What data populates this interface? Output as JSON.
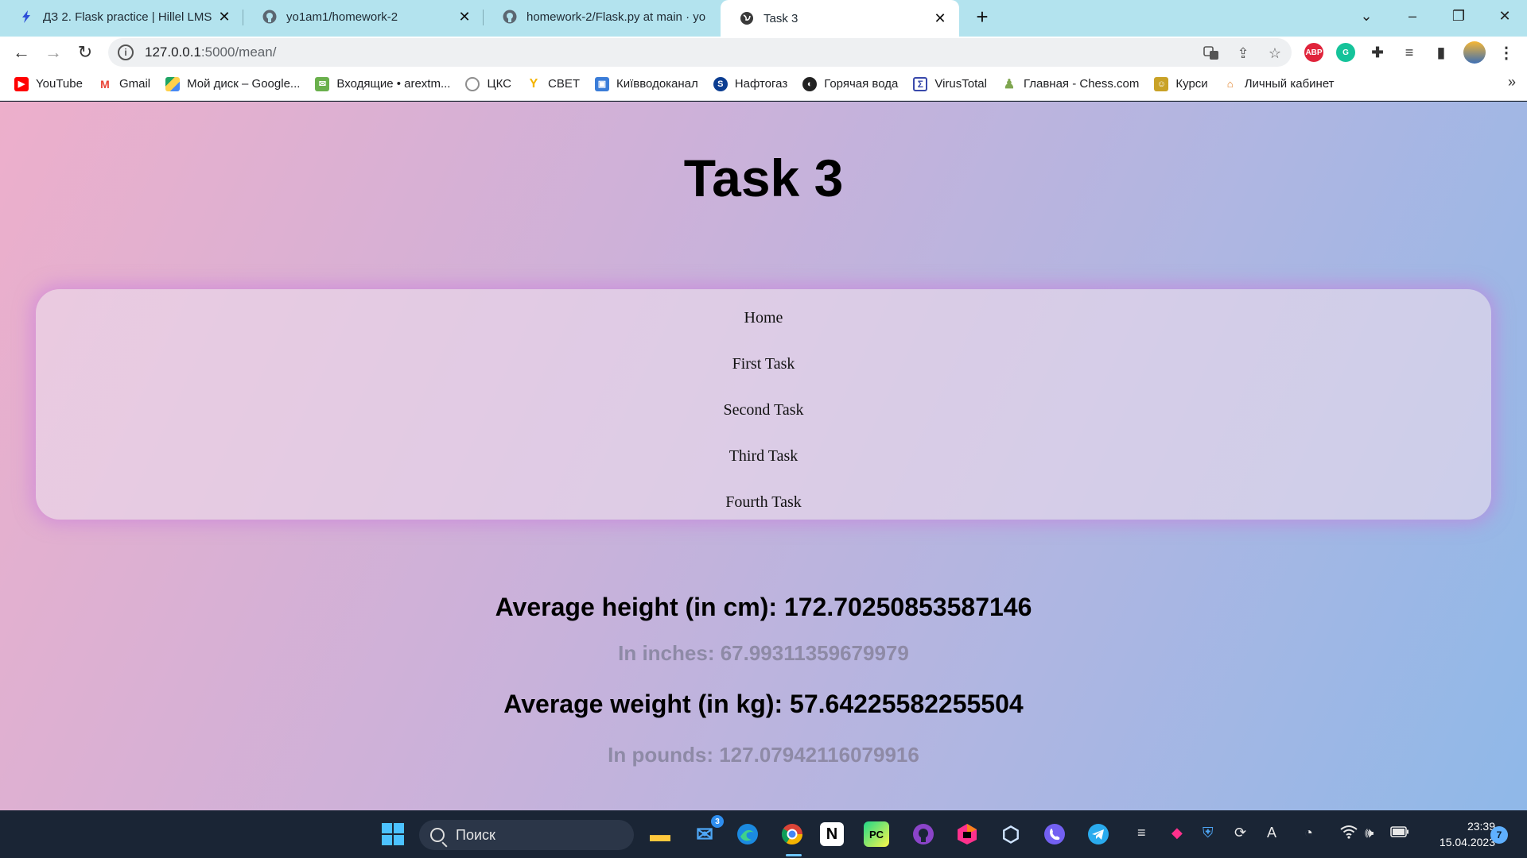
{
  "browser": {
    "tabs": [
      {
        "title": "ДЗ 2. Flask practice | Hillel LMS",
        "favicon": "hillel-icon",
        "active": false
      },
      {
        "title": "yo1am1/homework-2",
        "favicon": "github-icon",
        "active": false
      },
      {
        "title": "homework-2/Flask.py at main · yo",
        "favicon": "github-icon",
        "active": false
      },
      {
        "title": "Task 3",
        "favicon": "globe-icon",
        "active": true
      }
    ],
    "url_host": "127.0.0.1",
    "url_path": ":5000/mean/",
    "bookmarks": [
      {
        "label": "YouTube",
        "icon": "youtube-icon",
        "color": "#ff0000"
      },
      {
        "label": "Gmail",
        "icon": "gmail-icon",
        "color": "#ea4335"
      },
      {
        "label": "Мой диск – Google...",
        "icon": "google-drive-icon",
        "color": "#1fa463"
      },
      {
        "label": "Входящие • arextm...",
        "icon": "mail-icon",
        "color": "#6ab04c"
      },
      {
        "label": "ЦКС",
        "icon": "cks-icon",
        "color": "#8e8e8e"
      },
      {
        "label": "СВЕТ",
        "icon": "svet-icon",
        "color": "#f4b400"
      },
      {
        "label": "Київводоканал",
        "icon": "vodokanal-icon",
        "color": "#3b7dd8"
      },
      {
        "label": "Нафтогаз",
        "icon": "naftogaz-icon",
        "color": "#0b3d91"
      },
      {
        "label": "Горячая вода",
        "icon": "globe-icon",
        "color": "#222222"
      },
      {
        "label": "VirusTotal",
        "icon": "virustotal-icon",
        "color": "#3949ab"
      },
      {
        "label": "Главная - Chess.com",
        "icon": "chess-icon",
        "color": "#7fa650"
      },
      {
        "label": "Курси",
        "icon": "courses-icon",
        "color": "#c9a227"
      },
      {
        "label": "Личный кабинет",
        "icon": "cabinet-icon",
        "color": "#e07b1f"
      }
    ]
  },
  "page": {
    "title": "Task 3",
    "nav": [
      "Home",
      "First Task",
      "Second Task",
      "Third Task",
      "Fourth Task"
    ],
    "height_line": "Average height (in cm): 172.70250853587146",
    "inches_line": "In inches: 67.99311359679979",
    "weight_line": "Average weight (in kg): 57.64225582255504",
    "pounds_line": "In pounds: 127.07942116079916"
  },
  "taskbar": {
    "search_label": "Поиск",
    "mail_badge": "3",
    "time": "23:39",
    "date": "15.04.2023",
    "notifications": "7"
  }
}
